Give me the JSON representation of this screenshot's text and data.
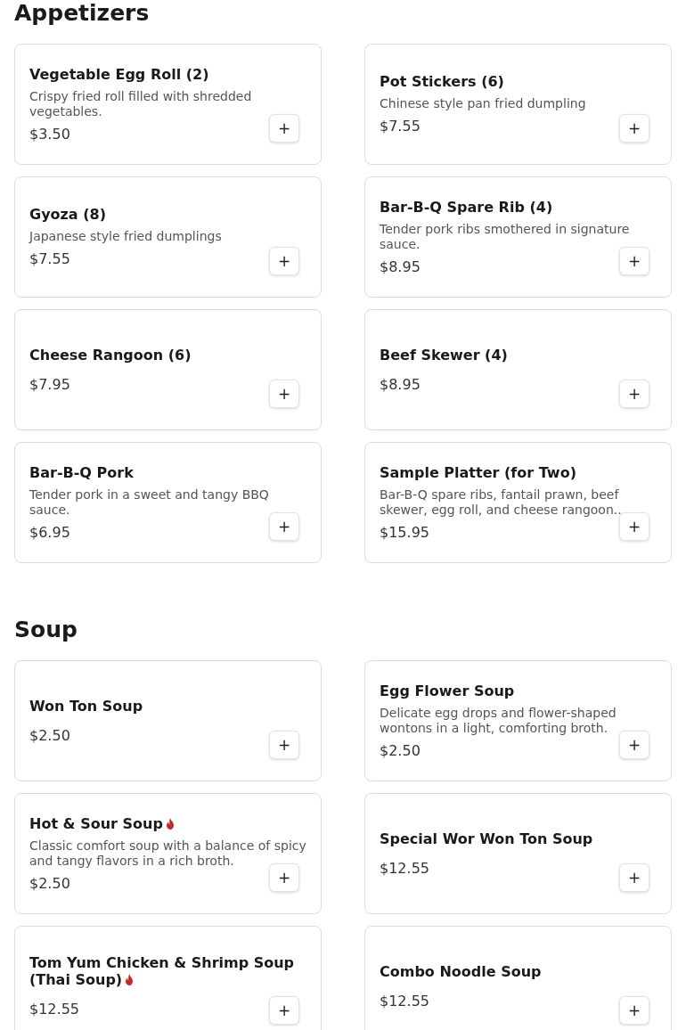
{
  "sections": [
    {
      "title": "Appetizers",
      "items": [
        {
          "name": "Vegetable Egg Roll (2)",
          "description": "Crispy fried roll filled with shredded vegetables.",
          "price": "$3.50",
          "spicy": false,
          "add": "+"
        },
        {
          "name": "Pot Stickers (6)",
          "description": "Chinese style pan fried dumpling",
          "price": "$7.55",
          "spicy": false,
          "add": "+"
        },
        {
          "name": "Gyoza (8)",
          "description": "Japanese style fried dumplings",
          "price": "$7.55",
          "spicy": false,
          "add": "+"
        },
        {
          "name": "Bar-B-Q Spare Rib (4)",
          "description": "Tender pork ribs smothered in signature sauce.",
          "price": "$8.95",
          "spicy": false,
          "add": "+"
        },
        {
          "name": "Cheese Rangoon (6)",
          "price": "$7.95",
          "spicy": false,
          "add": "+"
        },
        {
          "name": "Beef Skewer (4)",
          "price": "$8.95",
          "spicy": false,
          "add": "+"
        },
        {
          "name": "Bar-B-Q Pork",
          "description": "Tender pork in a sweet and tangy BBQ sauce.",
          "price": "$6.95",
          "spicy": false,
          "add": "+"
        },
        {
          "name": "Sample Platter (for Two)",
          "description": "Bar-B-Q spare ribs, fantail prawn, beef skewer, egg roll, and cheese rangoon..",
          "price": "$15.95",
          "spicy": false,
          "add": "+"
        }
      ]
    },
    {
      "title": "Soup",
      "items": [
        {
          "name": "Won Ton Soup",
          "price": "$2.50",
          "spicy": false,
          "add": "+"
        },
        {
          "name": "Egg Flower Soup",
          "description": "Delicate egg drops and flower-shaped wontons in a light, comforting broth.",
          "price": "$2.50",
          "spicy": false,
          "add": "+"
        },
        {
          "name": "Hot & Sour Soup",
          "description": "Classic comfort soup with a balance of spicy and tangy flavors in a rich broth.",
          "price": "$2.50",
          "spicy": true,
          "add": "+"
        },
        {
          "name": "Special Wor Won Ton Soup",
          "price": "$12.55",
          "spicy": false,
          "add": "+"
        },
        {
          "name": "Tom Yum Chicken & Shrimp Soup (Thai Soup)",
          "price": "$12.55",
          "spicy": true,
          "add": "+"
        },
        {
          "name": "Combo Noodle Soup",
          "price": "$12.55",
          "spicy": false,
          "add": "+"
        }
      ]
    }
  ]
}
